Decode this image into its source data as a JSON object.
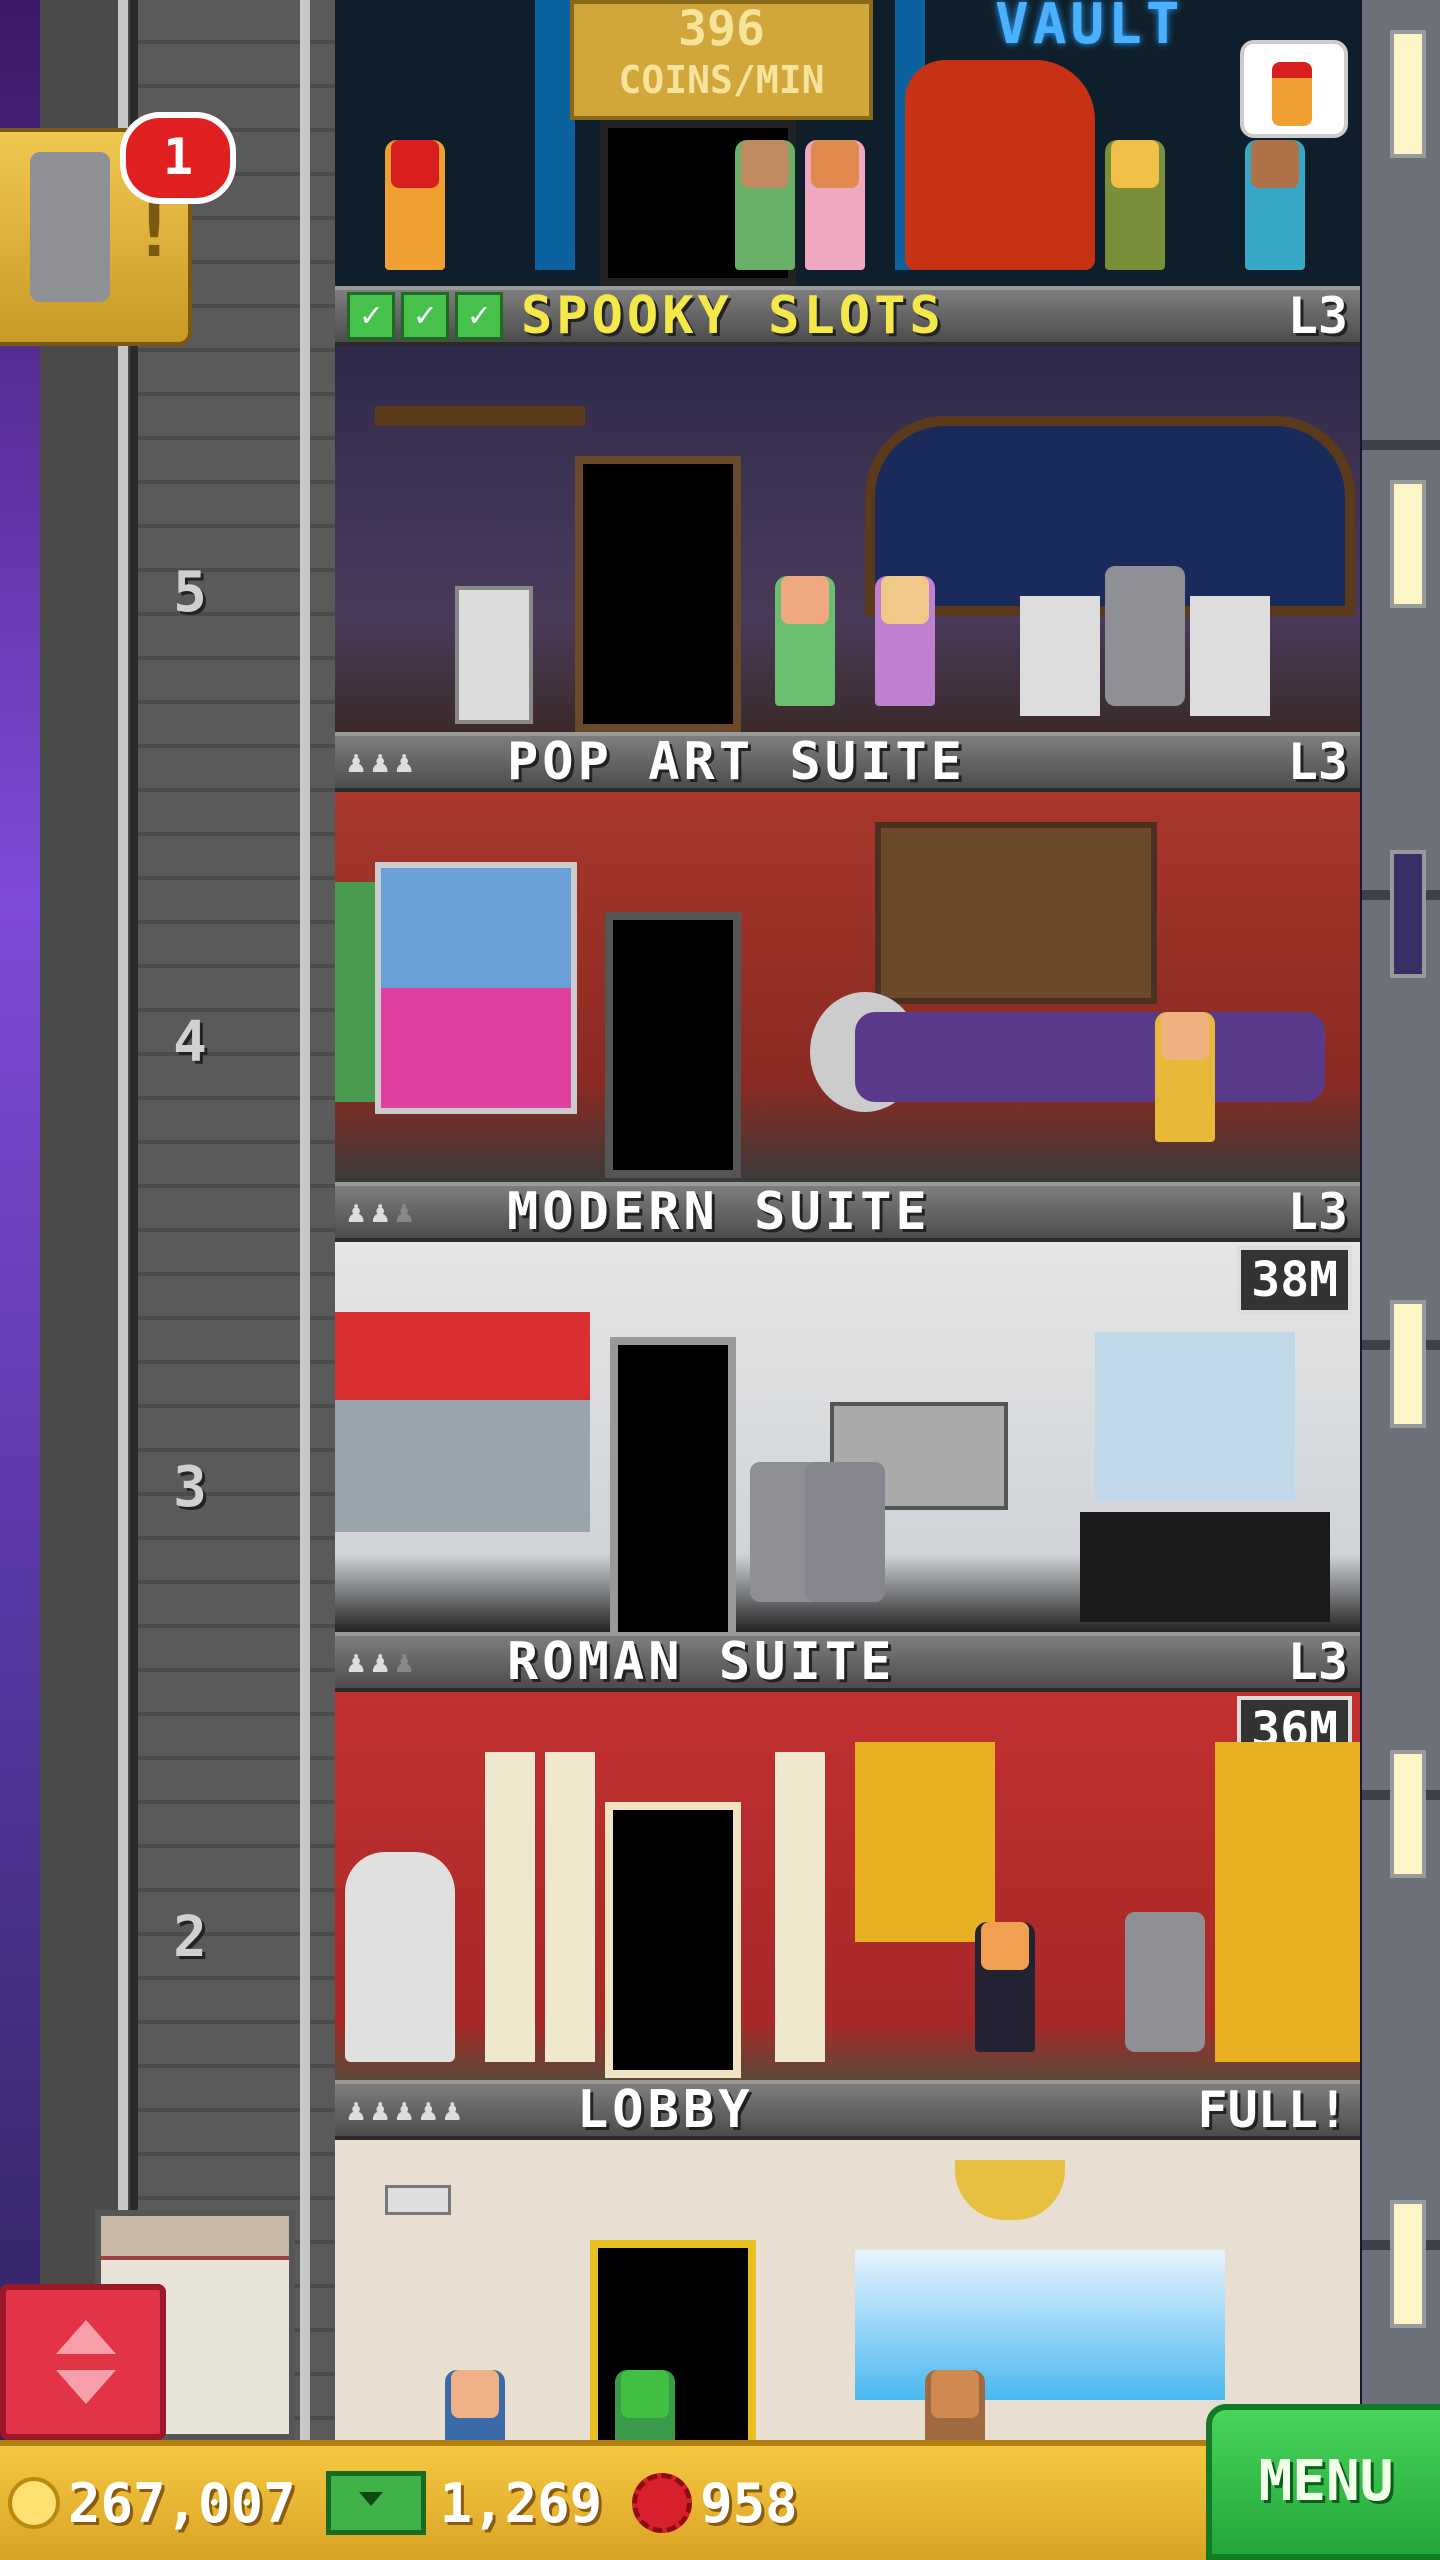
{
  "header": {
    "coins_per_min_value": "396",
    "coins_per_min_unit": "COINS/MIN",
    "vault_sign": "VAULT"
  },
  "notification": {
    "count": "1",
    "alert": "!"
  },
  "floors": [
    {
      "title": "SPOOKY SLOTS",
      "level": "L3",
      "floor_number": "5",
      "checks": 3,
      "price": ""
    },
    {
      "title": "POP ART SUITE",
      "level": "L3",
      "floor_number": "4",
      "occupancy": [
        true,
        true,
        true
      ],
      "price": ""
    },
    {
      "title": "MODERN SUITE",
      "level": "L3",
      "floor_number": "3",
      "occupancy": [
        true,
        true,
        false
      ],
      "price": "38M"
    },
    {
      "title": "ROMAN SUITE",
      "level": "L3",
      "floor_number": "2",
      "occupancy": [
        true,
        true,
        false
      ],
      "price": "36M"
    },
    {
      "title": "LOBBY",
      "level": "FULL!",
      "occupancy": [
        true,
        true,
        true,
        true,
        true
      ]
    }
  ],
  "bottom_bar": {
    "coins": "267,007",
    "tower_bux": "1,269",
    "gems": "958",
    "menu_label": "MENU"
  },
  "colors": {
    "accent_gold": "#f5c842",
    "menu_green": "#22a63a",
    "elevator_red": "#e23347",
    "badge_red": "#e02020"
  }
}
